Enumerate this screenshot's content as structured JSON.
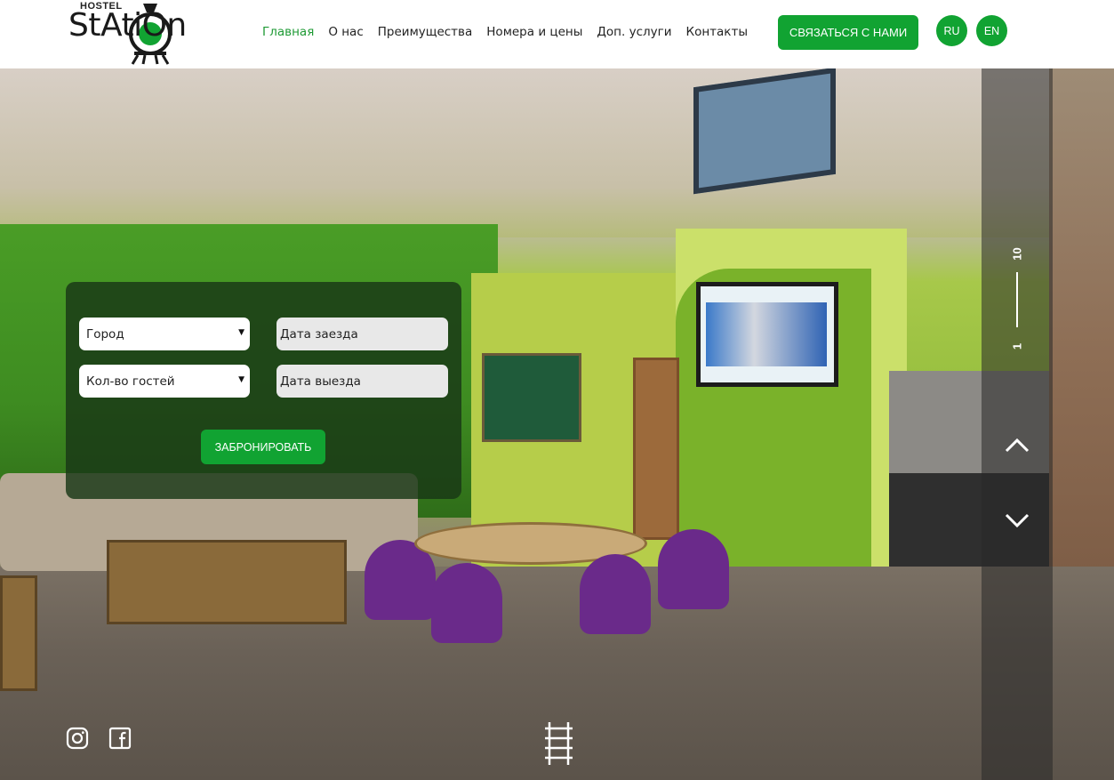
{
  "header": {
    "logo_small": "HOSTEL",
    "logo_word": "StAtiOn",
    "nav": [
      "Главная",
      "О нас",
      "Преимущества",
      "Номера и цены",
      "Доп. услуги",
      "Контакты"
    ],
    "active_nav_index": 0,
    "cta_label": "СВЯЗАТЬСЯ С НАМИ",
    "languages": [
      "RU",
      "EN"
    ]
  },
  "booking": {
    "city_placeholder": "Город",
    "guests_placeholder": "Кол-во гостей",
    "checkin_placeholder": "Дата заезда",
    "checkout_placeholder": "Дата выезда",
    "submit_label": "ЗАБРОНИРОВАТЬ"
  },
  "slider": {
    "total": "10",
    "current": "1"
  },
  "icons": {
    "social": [
      "instagram-icon",
      "facebook-icon"
    ],
    "scroll": "rails-icon",
    "arrows": [
      "chevron-up-icon",
      "chevron-down-icon"
    ]
  },
  "colors": {
    "accent": "#11a332",
    "active_nav": "#1e9a34",
    "text": "#222222",
    "form_overlay": "#19371680"
  }
}
